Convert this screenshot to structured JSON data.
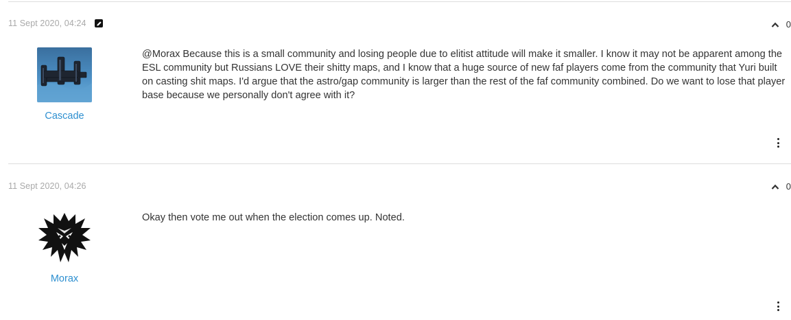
{
  "posts": [
    {
      "timestamp": "11 Sept 2020, 04:24",
      "edited_icon": "edit-pencil-icon",
      "votes": "0",
      "author": "Cascade",
      "avatar_icon": "spaceship-avatar",
      "content": "@Morax Because this is a small community and losing people due to elitist attitude will make it smaller. I know it may not be apparent among the ESL community but Russians LOVE their shitty maps, and I know that a huge source of new faf players come from the community that Yuri built on casting shit maps. I'd argue that the astro/gap community is larger than the rest of the faf community combined. Do we want to lose that player base because we personally don't agree with it?"
    },
    {
      "timestamp": "11 Sept 2020, 04:26",
      "votes": "0",
      "author": "Morax",
      "avatar_icon": "wolf-medallion-avatar",
      "content": "Okay then vote me out when the election comes up. Noted."
    }
  ],
  "colors": {
    "link": "#2d8fd0",
    "timestamp": "#a9a9a9",
    "divider": "#dcdcdc",
    "text": "#333333"
  }
}
